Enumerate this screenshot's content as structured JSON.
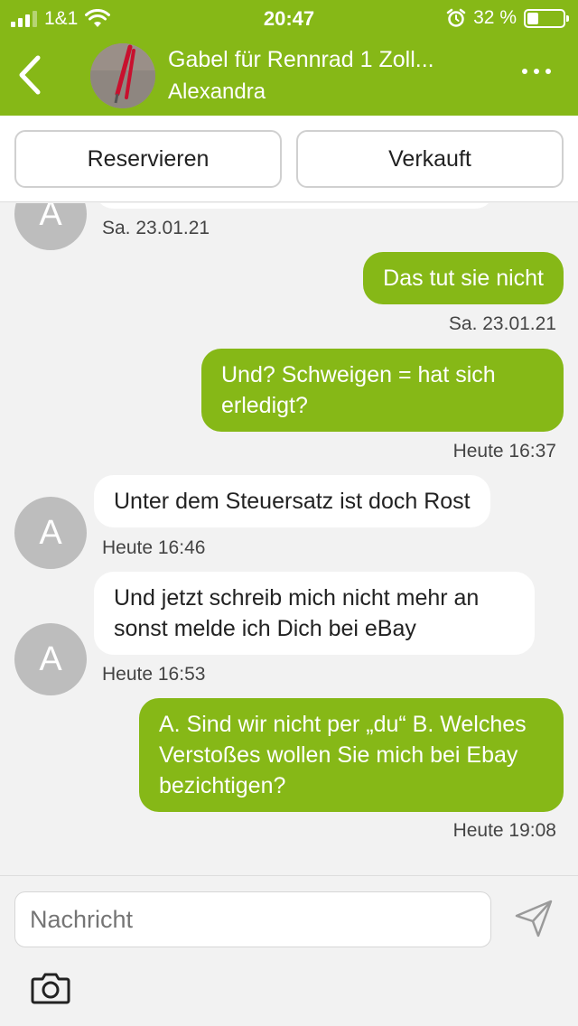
{
  "status_bar": {
    "carrier": "1&1",
    "time": "20:47",
    "battery_percent": "32 %",
    "battery_level": 0.32
  },
  "header": {
    "title": "Gabel für Rennrad 1 Zoll...",
    "subtitle": "Alexandra"
  },
  "actions": {
    "reserve_label": "Reservieren",
    "sold_label": "Verkauft"
  },
  "messages": [
    {
      "from": "them",
      "avatar_initial": "A",
      "text": "",
      "time": "Sa. 23.01.21"
    },
    {
      "from": "me",
      "text": "Das tut sie nicht",
      "time": "Sa. 23.01.21"
    },
    {
      "from": "me",
      "text": "Und? Schweigen = hat sich erledigt?",
      "time": "Heute 16:37"
    },
    {
      "from": "them",
      "avatar_initial": "A",
      "text": "Unter dem Steuersatz ist doch Rost",
      "time": "Heute 16:46"
    },
    {
      "from": "them",
      "avatar_initial": "A",
      "text": "Und jetzt schreib mich nicht mehr an sonst melde ich Dich bei eBay",
      "time": "Heute 16:53"
    },
    {
      "from": "me",
      "text": "A. Sind wir nicht per „du“ B. Welches Verstoßes wollen Sie mich bei Ebay bezichtigen?",
      "time": "Heute 19:08"
    }
  ],
  "composer": {
    "placeholder": "Nachricht"
  },
  "icons": {
    "back": "chevron-left-icon",
    "more": "more-icon",
    "send": "send-icon",
    "camera": "camera-icon"
  },
  "colors": {
    "brand_green": "#86b817",
    "background": "#f2f2f2",
    "incoming_bubble": "#ffffff",
    "avatar_gray": "#bdbdbd"
  }
}
